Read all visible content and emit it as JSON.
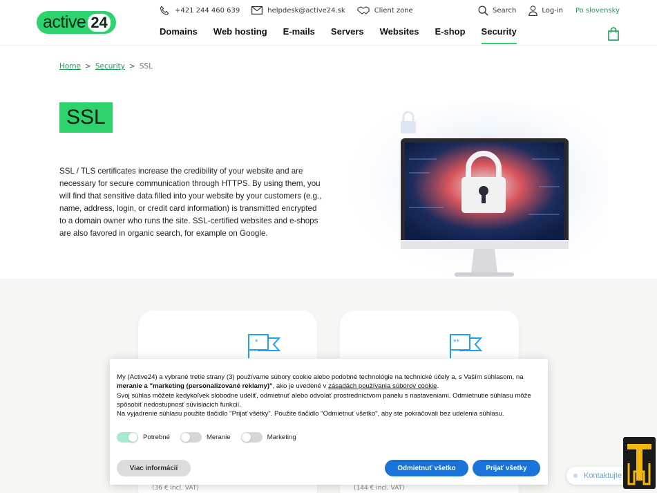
{
  "header": {
    "logo_text": "active",
    "logo_num": "24",
    "phone": "+421 244 460 639",
    "email": "helpdesk@active24.sk",
    "client_zone": "Client zone",
    "search": "Search",
    "login": "Log-in",
    "language": "Po slovensky",
    "nav": [
      "Domains",
      "Web hosting",
      "E-mails",
      "Servers",
      "Websites",
      "E-shop",
      "Security"
    ],
    "active_nav": "Security"
  },
  "breadcrumb": {
    "home": "Home",
    "sep": ">",
    "security": "Security",
    "current": "SSL"
  },
  "hero": {
    "title": "SSL",
    "text": "SSL / TLS certificates increase the credibility of your website and are necessary for secure communication through HTTPS. By using them, you will find that sensitive data filled into your website by your customers (e.g., name, address, login, or credit card information) is transmitted encrypted to a domain owner who runs the site. SSL-certified websites and e-shops are also favored in organic search, for example on Google."
  },
  "cards": [
    {
      "icon": "flag-one-star-icon",
      "price_note": "(36 € incl. VAT)"
    },
    {
      "icon": "flag-two-stars-icon",
      "price_note": "(144 € incl. VAT)"
    }
  ],
  "cookie": {
    "p1_a": "My (Active24) a vybrané tretie strany (3) používame súbory cookie alebo podobné technológie na technické účely a, s Vaším súhlasom, na ",
    "p1_b": "meranie a \"marketing (personalizované reklamy)\"",
    "p1_c": ", ako je uvedené v ",
    "p1_link": "zásadách používania súborov cookie",
    "p1_d": ".",
    "p2": "Svoj súhlas môžete kedykoľvek slobodne udeliť, odmietnuť alebo odvolať prostredníctvom panelu s nastaveniami. Odmietnutie súhlasu môže spôsobiť nedostupnosť súvisiacich funkcií.",
    "p3": "Na vyjadrenie súhlasu použite tlačidlo \"Prijať všetky\". Použite tlačidlo \"Odmietnuť všetko\", aby ste pokračovali bez udelenia súhlasu.",
    "toggles": [
      {
        "label": "Potrebné",
        "on": true
      },
      {
        "label": "Meranie",
        "on": false
      },
      {
        "label": "Marketing",
        "on": false
      }
    ],
    "btn_more": "Viac informácií",
    "btn_reject": "Odmietnuť všetko",
    "btn_accept": "Prijať všetky"
  },
  "contact": "Kontaktujte",
  "colors": {
    "brand_green": "#2fd36e",
    "link_green": "#1e9e55",
    "button_blue": "#1a73d9"
  }
}
